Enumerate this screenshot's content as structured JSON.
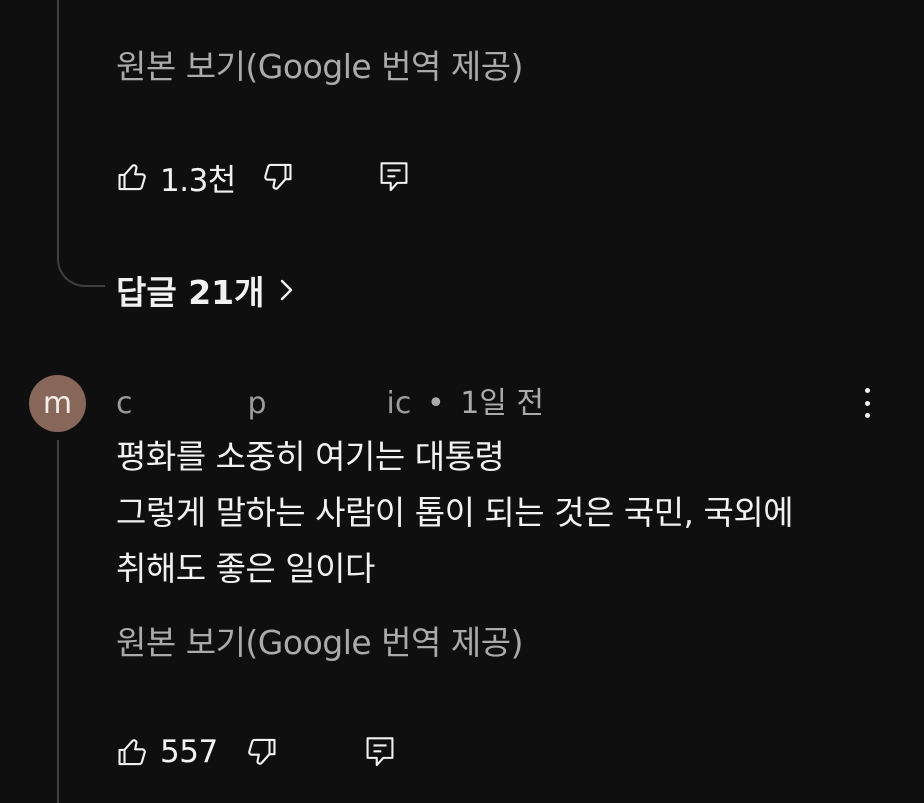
{
  "comment_1": {
    "see_original": "원본 보기(Google 번역 제공)",
    "like_count": "1.3천",
    "replies_label": "답글 21개"
  },
  "comment_2": {
    "avatar_letter": "m",
    "author_fragments": [
      "c",
      "p",
      "ic"
    ],
    "separator": "•",
    "time": "1일 전",
    "lines": [
      "평화를 소중히 여기는 대통령",
      "그렇게 말하는 사람이 톱이 되는 것은 국민, 국외에",
      "취해도 좋은 일이다"
    ],
    "see_original": "원본 보기(Google 번역 제공)",
    "like_count": "557"
  },
  "icons": {
    "like": "thumbs-up-icon",
    "dislike": "thumbs-down-icon",
    "reply": "comment-reply-icon",
    "more": "more-vertical-icon",
    "chevron": "chevron-right-icon"
  },
  "colors": {
    "background": "#0f0f0f",
    "text_primary": "#f1f1f1",
    "text_secondary": "#aaaaaa",
    "avatar_bg": "#86675a",
    "thread_line": "#3f3f3f"
  }
}
